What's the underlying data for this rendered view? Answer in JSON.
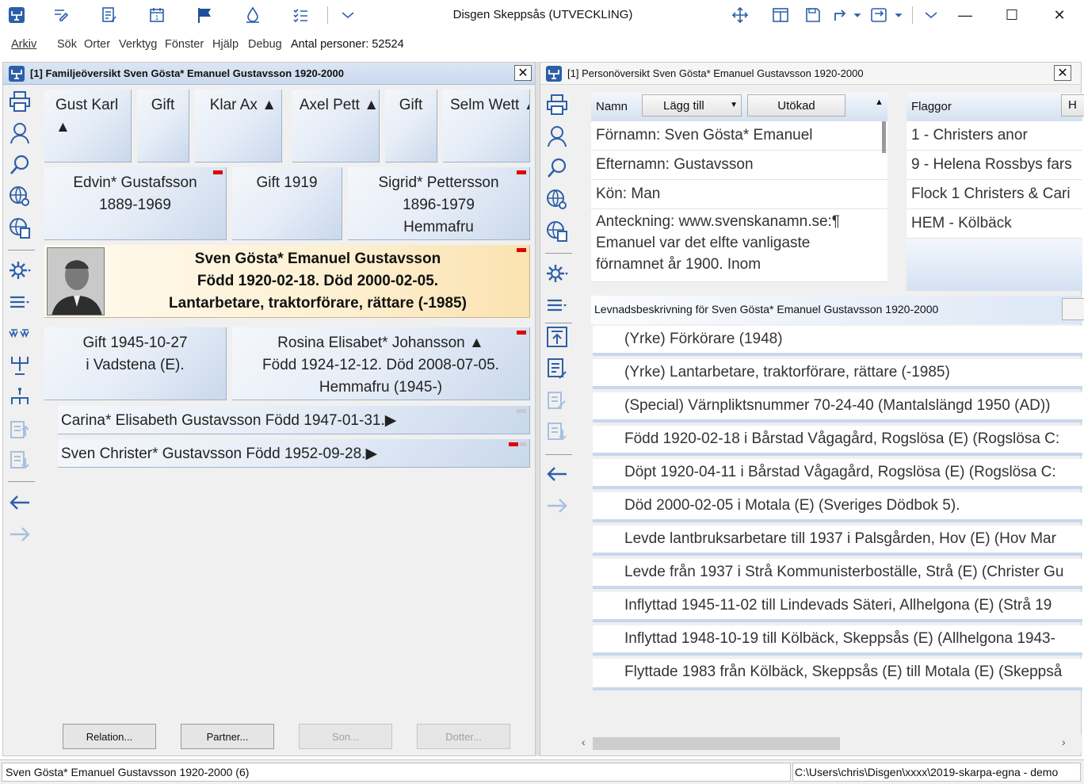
{
  "app": {
    "title": "Disgen Skeppsås (UTVECKLING)"
  },
  "menu": {
    "items": [
      "Arkiv",
      "Sök",
      "Orter",
      "Verktyg",
      "Fönster",
      "Hjälp",
      "Debug"
    ],
    "count_label": "Antal personer: 52524"
  },
  "left_pane": {
    "title": "[1] Familjeöversikt Sven Gösta* Emanuel Gustavsson 1920-2000",
    "grandparents": [
      "Gust Karl",
      "Gift",
      "Klar Ax",
      "Axel Pett",
      "Gift",
      "Selm Wett"
    ],
    "father": {
      "name": "Edvin* Gustafsson",
      "years": "1889-1969"
    },
    "parents_marriage": "Gift 1919",
    "mother": {
      "name": "Sigrid* Pettersson",
      "years": "1896-1979",
      "occupation": "Hemmafru"
    },
    "main_person": {
      "name": "Sven Gösta* Emanuel Gustavsson",
      "dates": "Född 1920-02-18. Död 2000-02-05.",
      "occupation": "Lantarbetare, traktorförare, rättare (-1985)"
    },
    "marriage": {
      "line1": "Gift 1945-10-27",
      "line2": "i Vadstena (E)."
    },
    "spouse": {
      "name": "Rosina Elisabet* Johansson",
      "dates": "Född 1924-12-12. Död 2008-07-05.",
      "occupation": "Hemmafru (1945-)"
    },
    "children": [
      "Carina* Elisabeth Gustavsson Född 1947-01-31.",
      "Sven Christer* Gustavsson Född 1952-09-28."
    ],
    "buttons": {
      "relation": "Relation...",
      "partner": "Partner...",
      "son": "Son...",
      "daughter": "Dotter..."
    }
  },
  "right_pane": {
    "title": "[1] Personöversikt Sven Gösta* Emanuel Gustavsson 1920-2000",
    "name_header": "Namn",
    "add_button": "Lägg till",
    "expand_button": "Utökad",
    "fields": {
      "first_name": "Förnamn: Sven Gösta* Emanuel",
      "last_name": "Efternamn: Gustavsson",
      "gender": "Kön: Man",
      "note_line1": "Anteckning: www.svenskanamn.se:¶",
      "note_line2": "Emanuel var det elfte vanligaste",
      "note_line3": "förnamnet år 1900. Inom"
    },
    "flags_header": "Flaggor",
    "flags": [
      "1 - Christers anor",
      "9 - Helena Rossbys fars",
      "Flock 1 Christers & Cari",
      "HEM - Kölbäck"
    ],
    "bio_title": "Levnadsbeskrivning för Sven Gösta* Emanuel Gustavsson 1920-2000",
    "events": [
      "(Yrke) Förkörare (1948)",
      "(Yrke) Lantarbetare, traktorförare, rättare (-1985)",
      "(Special) Värnpliktsnummer 70-24-40 (Mantalslängd 1950 (AD))",
      "Född 1920-02-18 i Bårstad Vågagård, Rogslösa (E) (Rogslösa C:",
      "Döpt 1920-04-11 i Bårstad Vågagård, Rogslösa (E) (Rogslösa C:",
      "Död 2000-02-05 i Motala (E) (Sveriges Dödbok 5).",
      "Levde lantbruksarbetare till 1937 i Palsgården, Hov (E) (Hov Mar",
      "Levde från 1937 i Strå Kommunisterboställe, Strå (E) (Christer Gu",
      "Inflyttad 1945-11-02 till Lindevads Säteri, Allhelgona (E) (Strå 19",
      "Inflyttad 1948-10-19 till Kölbäck, Skeppsås (E) (Allhelgona 1943-",
      "Flyttade 1983 från Kölbäck, Skeppsås (E) till Motala (E) (Skeppså"
    ]
  },
  "status": {
    "left": "Sven Gösta* Emanuel Gustavsson 1920-2000 (6)",
    "right": "C:\\Users\\chris\\Disgen\\xxxx\\2019-skarpa-egna - demo"
  }
}
